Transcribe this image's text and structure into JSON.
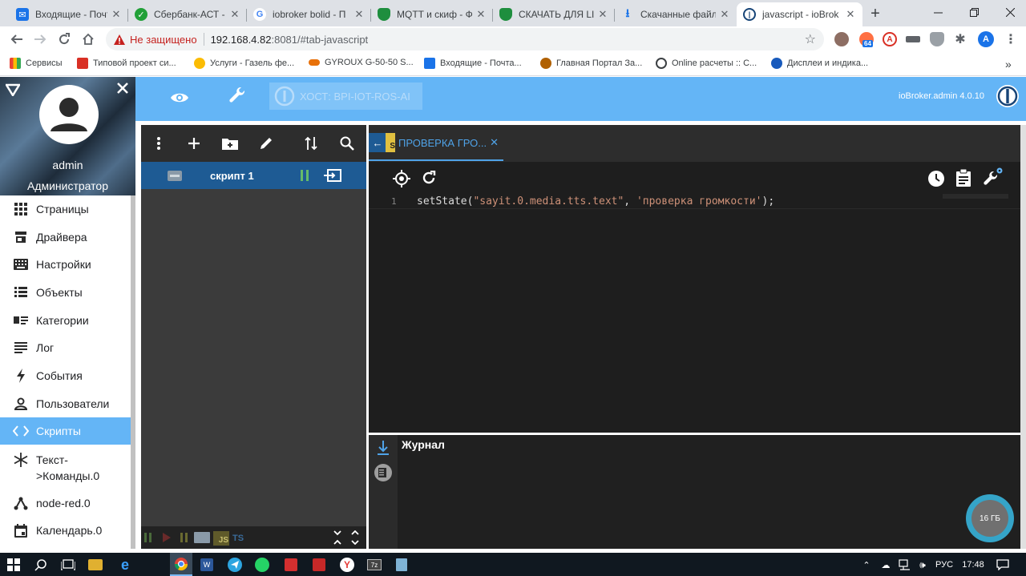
{
  "browser": {
    "tabs": [
      {
        "title": "Входящие - Почта",
        "icon": "mail-icon",
        "color": "#1a73e8"
      },
      {
        "title": "Сбербанк-АСТ - з",
        "icon": "sberbank-icon",
        "color": "#21a038"
      },
      {
        "title": "iobroker bolid - П",
        "icon": "google-icon",
        "color": "#4285f4"
      },
      {
        "title": "MQTT и скиф - Фо",
        "icon": "shield-icon",
        "color": "#1e8e3e"
      },
      {
        "title": "СКАЧАТЬ ДЛЯ LIN",
        "icon": "shield-icon",
        "color": "#1e8e3e"
      },
      {
        "title": "Скачанные файлы",
        "icon": "download-icon",
        "color": "#1a73e8"
      },
      {
        "title": "javascript - ioBrok",
        "icon": "iobroker-icon",
        "color": "#164477"
      }
    ],
    "new_tab": "+",
    "security_label": "Не защищено",
    "url_host": "192.168.4.82",
    "url_rest": ":8081/#tab-javascript",
    "bookmarks": [
      {
        "label": "Сервисы",
        "color": "#ea4335"
      },
      {
        "label": "Типовой проект си...",
        "color": "#d93025"
      },
      {
        "label": "Услуги - Газель фе...",
        "color": "#fbbc04"
      },
      {
        "label": "GYROUX G-50-50 S...",
        "color": "#e8710a"
      },
      {
        "label": "Входящие - Почта...",
        "color": "#1a73e8"
      },
      {
        "label": "Главная Портал За...",
        "color": "#b06000"
      },
      {
        "label": "Online расчеты :: С...",
        "color": "#3c4043"
      },
      {
        "label": "Дисплеи и индика...",
        "color": "#185abc"
      }
    ],
    "ext_badge": "64",
    "profile_letter": "A",
    "more_bookmarks": "»"
  },
  "app": {
    "host_label": "ХОСТ: BPI-IOT-ROS-AI",
    "version": "ioBroker.admin 4.0.10",
    "user": {
      "name": "admin",
      "role": "Администратор"
    },
    "menu": [
      {
        "label": "Страницы",
        "icon": "grid-icon"
      },
      {
        "label": "Драйвера",
        "icon": "store-icon"
      },
      {
        "label": "Настройки",
        "icon": "keyboard-icon"
      },
      {
        "label": "Объекты",
        "icon": "list-icon"
      },
      {
        "label": "Категории",
        "icon": "category-icon"
      },
      {
        "label": "Лог",
        "icon": "log-icon"
      },
      {
        "label": "События",
        "icon": "flash-icon"
      },
      {
        "label": "Пользователи",
        "icon": "person-icon"
      },
      {
        "label": "Скрипты",
        "icon": "code-icon"
      },
      {
        "label": "Текст-\n>Команды.0",
        "icon": "snowflake-icon"
      },
      {
        "label": "node-red.0",
        "icon": "node-red-icon"
      },
      {
        "label": "Календарь.0",
        "icon": "calendar-icon"
      }
    ],
    "selected_menu": "Скрипты",
    "script_name": "скрипт 1",
    "editor_tab": "ПРОВЕРКА ГРО...",
    "code": {
      "line_number": "1",
      "fn": "setState(",
      "arg1": "\"sayit.0.media.tts.text\"",
      "comma": ", ",
      "arg2": "'проверка громкости'",
      "end": ");"
    },
    "log_title": "Журнал",
    "memory": "16 ГБ",
    "accent": "#64b5f6"
  },
  "taskbar": {
    "language": "РУС",
    "time": "17:48"
  }
}
